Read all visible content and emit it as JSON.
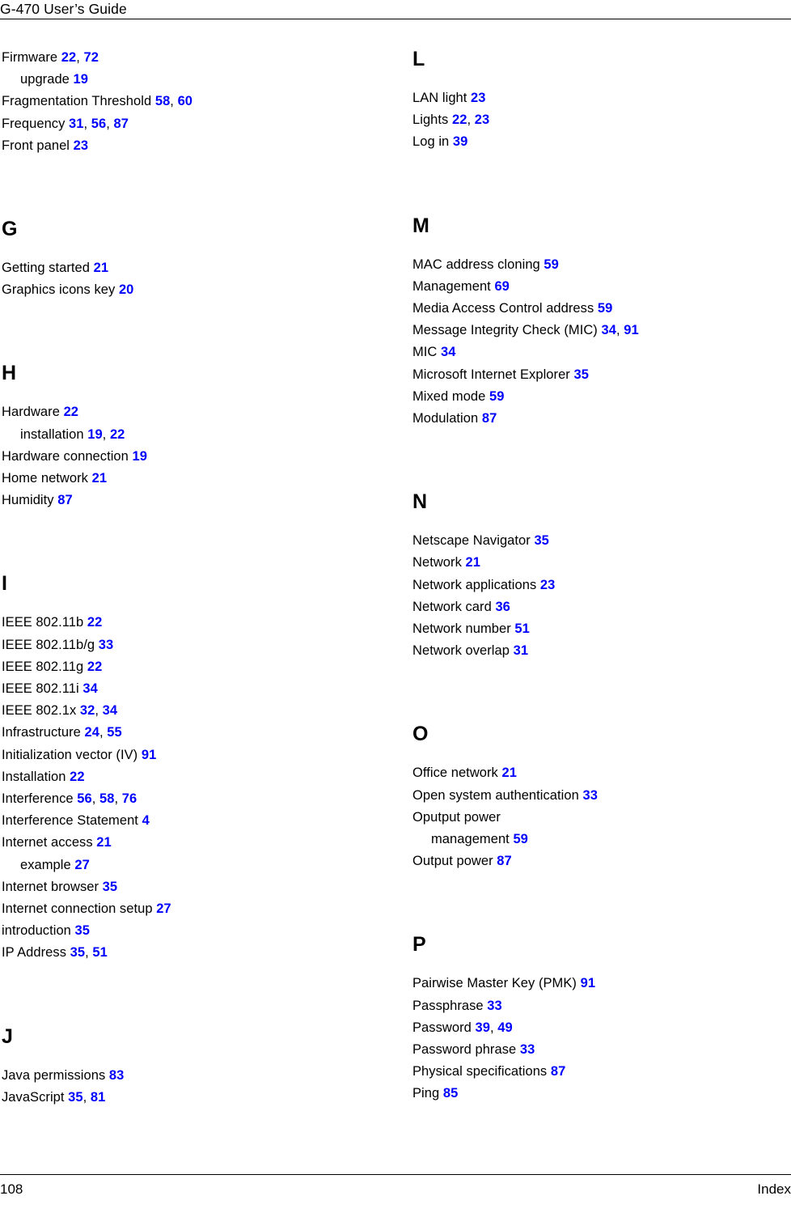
{
  "document": {
    "header_title": "G-470 User’s Guide",
    "footer_page_number": "108",
    "footer_section_label": "Index",
    "page_number_color": "#0000ff",
    "text_color": "#000000"
  },
  "columns": [
    {
      "name": "left-column",
      "sections": [
        {
          "letter": "",
          "entries": [
            {
              "text": "Firmware",
              "pages": [
                "22",
                "72"
              ],
              "sub": false
            },
            {
              "text": "upgrade",
              "pages": [
                "19"
              ],
              "sub": true
            },
            {
              "text": "Fragmentation Threshold",
              "pages": [
                "58",
                "60"
              ],
              "sub": false
            },
            {
              "text": "Frequency",
              "pages": [
                "31",
                "56",
                "87"
              ],
              "sub": false
            },
            {
              "text": "Front panel",
              "pages": [
                "23"
              ],
              "sub": false
            }
          ]
        },
        {
          "letter": "G",
          "entries": [
            {
              "text": "Getting started",
              "pages": [
                "21"
              ],
              "sub": false
            },
            {
              "text": "Graphics icons key",
              "pages": [
                "20"
              ],
              "sub": false
            }
          ]
        },
        {
          "letter": "H",
          "entries": [
            {
              "text": "Hardware",
              "pages": [
                "22"
              ],
              "sub": false
            },
            {
              "text": "installation",
              "pages": [
                "19",
                "22"
              ],
              "sub": true
            },
            {
              "text": "Hardware connection",
              "pages": [
                "19"
              ],
              "sub": false
            },
            {
              "text": "Home network",
              "pages": [
                "21"
              ],
              "sub": false
            },
            {
              "text": "Humidity",
              "pages": [
                "87"
              ],
              "sub": false
            }
          ]
        },
        {
          "letter": "I",
          "entries": [
            {
              "text": "IEEE 802.11b",
              "pages": [
                "22"
              ],
              "sub": false
            },
            {
              "text": "IEEE 802.11b/g",
              "pages": [
                "33"
              ],
              "sub": false
            },
            {
              "text": "IEEE 802.11g",
              "pages": [
                "22"
              ],
              "sub": false
            },
            {
              "text": "IEEE 802.11i",
              "pages": [
                "34"
              ],
              "sub": false
            },
            {
              "text": "IEEE 802.1x",
              "pages": [
                "32",
                "34"
              ],
              "sub": false
            },
            {
              "text": "Infrastructure",
              "pages": [
                "24",
                "55"
              ],
              "sub": false
            },
            {
              "text": "Initialization vector (IV)",
              "pages": [
                "91"
              ],
              "sub": false
            },
            {
              "text": "Installation",
              "pages": [
                "22"
              ],
              "sub": false
            },
            {
              "text": "Interference",
              "pages": [
                "56",
                "58",
                "76"
              ],
              "sub": false
            },
            {
              "text": "Interference Statement",
              "pages": [
                "4"
              ],
              "sub": false
            },
            {
              "text": "Internet access",
              "pages": [
                "21"
              ],
              "sub": false
            },
            {
              "text": "example",
              "pages": [
                "27"
              ],
              "sub": true
            },
            {
              "text": "Internet browser",
              "pages": [
                "35"
              ],
              "sub": false
            },
            {
              "text": "Internet connection setup",
              "pages": [
                "27"
              ],
              "sub": false
            },
            {
              "text": "introduction",
              "pages": [
                "35"
              ],
              "sub": false
            },
            {
              "text": "IP Address",
              "pages": [
                "35",
                "51"
              ],
              "sub": false
            }
          ]
        },
        {
          "letter": "J",
          "entries": [
            {
              "text": "Java permissions",
              "pages": [
                "83"
              ],
              "sub": false
            },
            {
              "text": "JavaScript",
              "pages": [
                "35",
                "81"
              ],
              "sub": false
            }
          ]
        }
      ]
    },
    {
      "name": "right-column",
      "sections": [
        {
          "letter": "L",
          "entries": [
            {
              "text": "LAN light",
              "pages": [
                "23"
              ],
              "sub": false
            },
            {
              "text": "Lights",
              "pages": [
                "22",
                "23"
              ],
              "sub": false
            },
            {
              "text": "Log in",
              "pages": [
                "39"
              ],
              "sub": false
            }
          ]
        },
        {
          "letter": "M",
          "entries": [
            {
              "text": "MAC address cloning",
              "pages": [
                "59"
              ],
              "sub": false
            },
            {
              "text": "Management",
              "pages": [
                "69"
              ],
              "sub": false
            },
            {
              "text": "Media Access Control address",
              "pages": [
                "59"
              ],
              "sub": false
            },
            {
              "text": "Message Integrity Check (MIC)",
              "pages": [
                "34",
                "91"
              ],
              "sub": false
            },
            {
              "text": "MIC",
              "pages": [
                "34"
              ],
              "sub": false
            },
            {
              "text": "Microsoft Internet Explorer",
              "pages": [
                "35"
              ],
              "sub": false
            },
            {
              "text": "Mixed mode",
              "pages": [
                "59"
              ],
              "sub": false
            },
            {
              "text": "Modulation",
              "pages": [
                "87"
              ],
              "sub": false
            }
          ]
        },
        {
          "letter": "N",
          "entries": [
            {
              "text": "Netscape Navigator",
              "pages": [
                "35"
              ],
              "sub": false
            },
            {
              "text": "Network",
              "pages": [
                "21"
              ],
              "sub": false
            },
            {
              "text": "Network applications",
              "pages": [
                "23"
              ],
              "sub": false
            },
            {
              "text": "Network card",
              "pages": [
                "36"
              ],
              "sub": false
            },
            {
              "text": "Network number",
              "pages": [
                "51"
              ],
              "sub": false
            },
            {
              "text": "Network overlap",
              "pages": [
                "31"
              ],
              "sub": false
            }
          ]
        },
        {
          "letter": "O",
          "entries": [
            {
              "text": "Office network",
              "pages": [
                "21"
              ],
              "sub": false
            },
            {
              "text": "Open system authentication",
              "pages": [
                "33"
              ],
              "sub": false
            },
            {
              "text": "Oputput power",
              "pages": [],
              "sub": false
            },
            {
              "text": "management",
              "pages": [
                "59"
              ],
              "sub": true
            },
            {
              "text": "Output power",
              "pages": [
                "87"
              ],
              "sub": false
            }
          ]
        },
        {
          "letter": "P",
          "entries": [
            {
              "text": "Pairwise Master Key (PMK)",
              "pages": [
                "91"
              ],
              "sub": false
            },
            {
              "text": "Passphrase",
              "pages": [
                "33"
              ],
              "sub": false
            },
            {
              "text": "Password",
              "pages": [
                "39",
                "49"
              ],
              "sub": false
            },
            {
              "text": "Password phrase",
              "pages": [
                "33"
              ],
              "sub": false
            },
            {
              "text": "Physical specifications",
              "pages": [
                "87"
              ],
              "sub": false
            },
            {
              "text": "Ping",
              "pages": [
                "85"
              ],
              "sub": false
            }
          ]
        }
      ]
    }
  ]
}
